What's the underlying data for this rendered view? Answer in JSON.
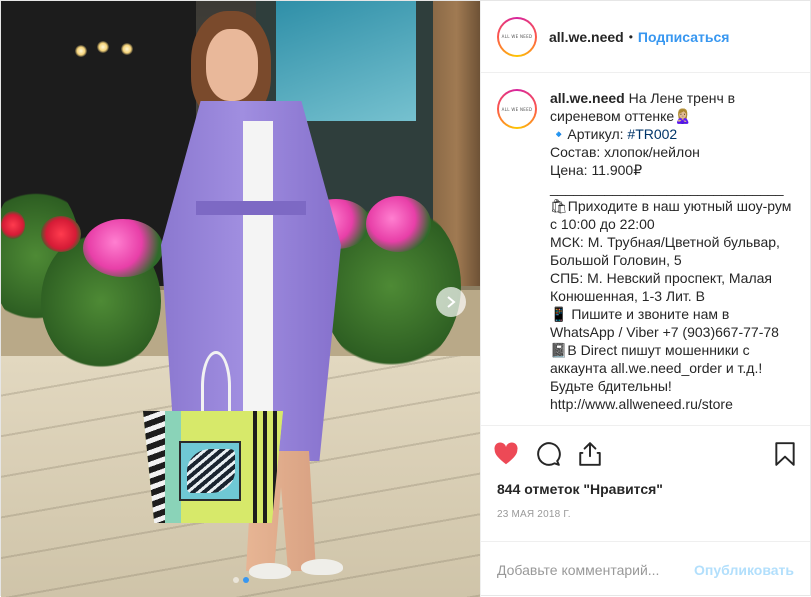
{
  "header": {
    "avatar_text": "ALL WE NEED",
    "username": "all.we.need",
    "separator": "•",
    "follow_label": "Подписаться"
  },
  "caption": {
    "username": "all.we.need",
    "text_before_tag": " На Лене тренч в сиреневом оттенке🙎🏼‍♀️\n🔹Артикул: ",
    "tag": "#TR002",
    "text_after_tag": "\nСостав: хлопок/нейлон\nЦена: 11.900₽\n______________________________\n🛍Приходите в наш уютный шоу-рум с 10:00 до 22:00\nМСК: М. Трубная/Цветной бульвар, Большой Головин, 5\nСПБ: М. Невский проспект, Малая Конюшенная, 1-3 Лит. В\n📱 Пишите и звоните нам в WhatsApp / Viber +7 (903)667-77-78\n📓В Direct пишут мошенники с аккаунта all.we.need_order и т.д.! Будьте бдительны!\nhttp://www.allweneed.ru/store"
  },
  "actions": {
    "icons": [
      "heart-icon",
      "comment-icon",
      "share-icon",
      "bookmark-icon"
    ],
    "like_color": "#ed4956"
  },
  "likes_text": "844 отметок \"Нравится\"",
  "date_text": "23 мая 2018 г.",
  "comment": {
    "placeholder": "Добавьте комментарий...",
    "value": "",
    "publish_label": "Опубликовать"
  },
  "carousel": {
    "current_index": 1,
    "count": 2
  },
  "colors": {
    "accent": "#3897f0",
    "publish_disabled": "#b2dffc",
    "tag": "#003569"
  }
}
